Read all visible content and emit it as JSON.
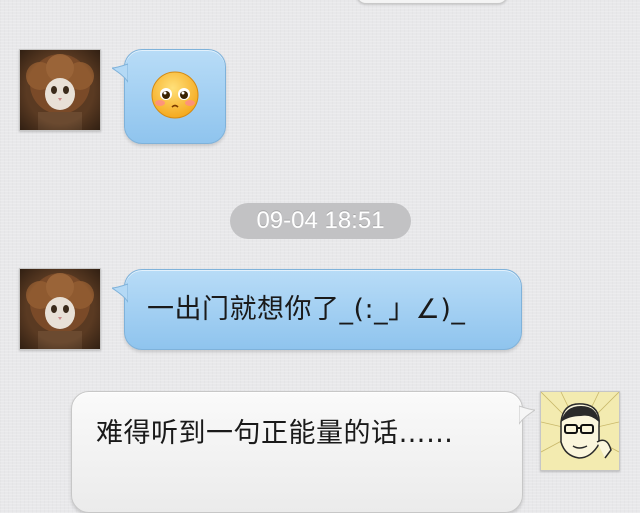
{
  "conversation": {
    "timestamp": "09-04 18:51",
    "messages": [
      {
        "sender": "contact",
        "type": "emoji",
        "emoji": "blush-face"
      },
      {
        "sender": "contact",
        "type": "text",
        "text": "一出门就想你了_(:_」∠)_"
      },
      {
        "sender": "me",
        "type": "text",
        "text": "难得听到一句正能量的话……"
      }
    ]
  },
  "colors": {
    "incoming_bubble": "#a7d2f3",
    "outgoing_bubble": "#f2f2f2",
    "timestamp_pill": "#c2c2c4",
    "background": "#e8e8ea"
  },
  "icons": {
    "contact_avatar": "cat-with-wig-avatar",
    "my_avatar": "glasses-man-sketch-avatar",
    "emoji": "blush-face-icon"
  }
}
